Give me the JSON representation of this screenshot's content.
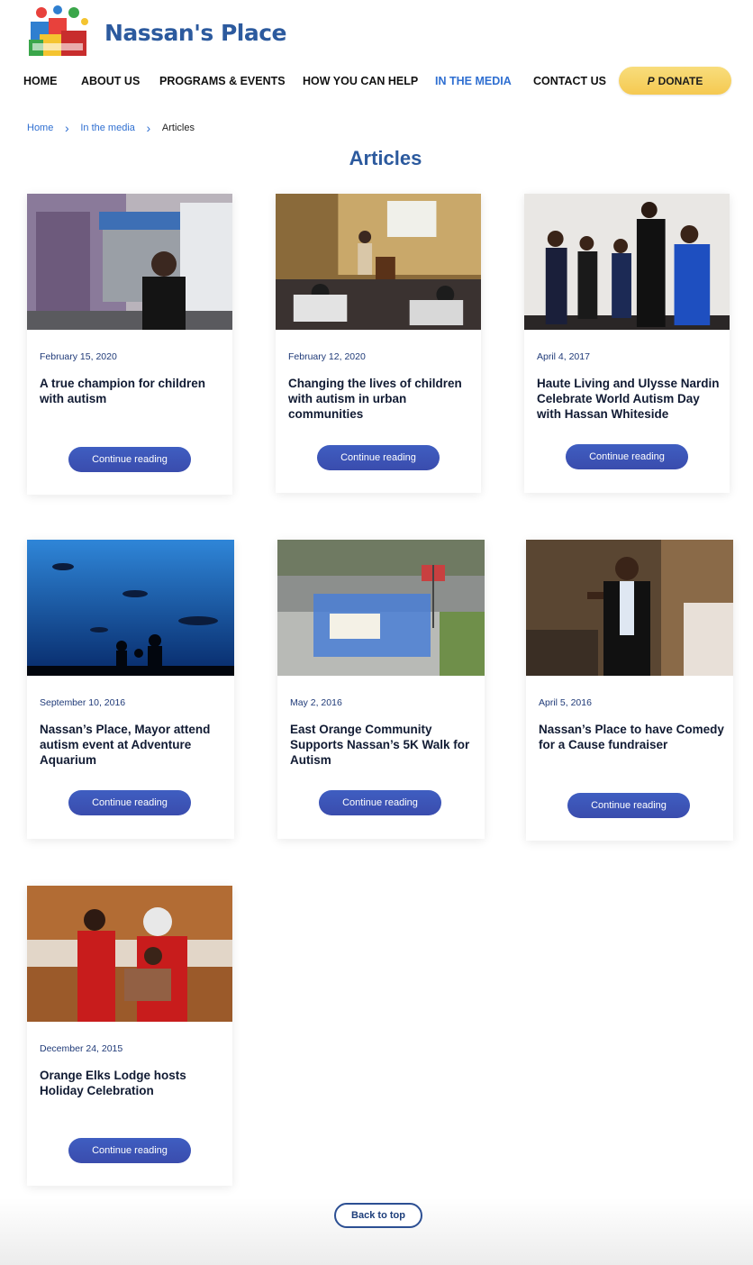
{
  "site": {
    "brand": "Nassan's Place"
  },
  "nav": {
    "items": [
      {
        "label": "HOME"
      },
      {
        "label": "ABOUT US"
      },
      {
        "label": "PROGRAMS & EVENTS"
      },
      {
        "label": "HOW YOU CAN HELP"
      },
      {
        "label": "IN THE MEDIA"
      },
      {
        "label": "CONTACT US"
      }
    ],
    "active_index": 4,
    "donate_label": "DONATE"
  },
  "breadcrumb": {
    "home": "Home",
    "section": "In the media",
    "current": "Articles"
  },
  "page_title": "Articles",
  "articles": [
    {
      "date": "February 15, 2020",
      "title": "A true champion for children with autism",
      "button": "Continue reading"
    },
    {
      "date": "February 12, 2020",
      "title": "Changing the lives of children with autism in urban communities",
      "button": "Continue reading"
    },
    {
      "date": "April 4, 2017",
      "title": "Haute Living and Ulysse Nardin Celebrate World Autism Day with Hassan Whiteside",
      "button": "Continue reading"
    },
    {
      "date": "September 10, 2016",
      "title": "Nassan’s Place, Mayor attend autism event at Adventure Aquarium",
      "button": "Continue reading"
    },
    {
      "date": "May 2, 2016",
      "title": "East Orange Community Supports Nassan’s 5K Walk for Autism",
      "button": "Continue reading"
    },
    {
      "date": "April 5, 2016",
      "title": "Nassan’s Place to have Comedy for a Cause fundraiser",
      "button": "Continue reading"
    },
    {
      "date": "December 24, 2015",
      "title": "Orange Elks Lodge hosts Holiday Celebration",
      "button": "Continue reading"
    }
  ],
  "back_to_top": "Back to top",
  "colors": {
    "brand_blue": "#2c5a9e",
    "link_blue": "#2f6fd1",
    "button_blue": "#3f5ec1",
    "donate_yellow": "#f6cf5e"
  }
}
